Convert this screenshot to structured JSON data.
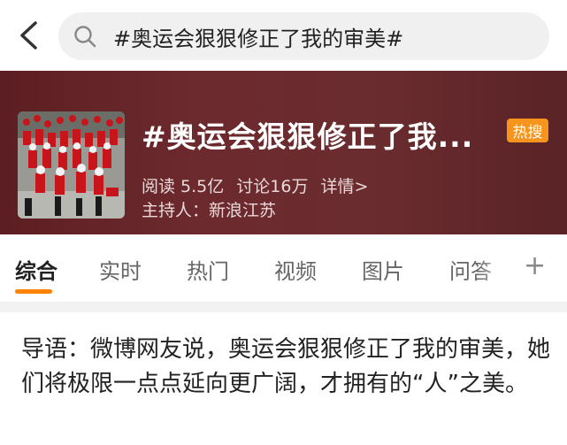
{
  "search": {
    "query": "#奥运会狠狠修正了我的审美#"
  },
  "topic": {
    "title": "#奥运会狠狠修正了我...",
    "badge": "热搜",
    "reads": "阅读 5.5亿",
    "discussions": "讨论16万",
    "details": "详情>",
    "host": "主持人：新浪江苏"
  },
  "tabs": [
    {
      "label": "综合"
    },
    {
      "label": "实时"
    },
    {
      "label": "热门"
    },
    {
      "label": "视频"
    },
    {
      "label": "图片"
    },
    {
      "label": "问答"
    }
  ],
  "intro": {
    "text": "导语：微博网友说，奥运会狠狠修正了我的审美，她们将极限一点点延向更广阔，才拥有的“人”之美。"
  },
  "colors": {
    "accent": "#ff8200",
    "badge": "#f7941d",
    "hero_bg": "#6a2c2f"
  }
}
